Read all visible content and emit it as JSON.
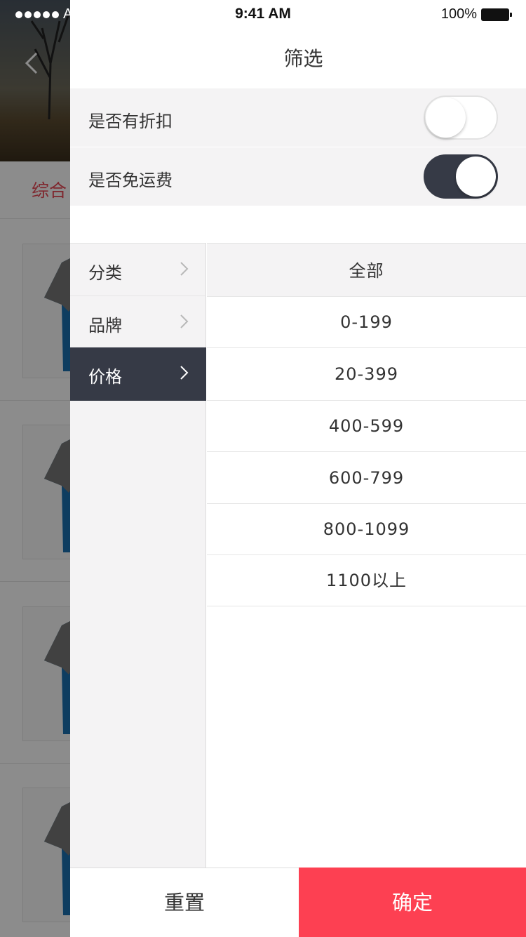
{
  "status_bar": {
    "carrier": "AT&T",
    "time": "9:41 AM",
    "battery": "100%"
  },
  "background": {
    "sort_label": "综合",
    "back_icon": "chevron-left-icon"
  },
  "filter": {
    "title": "筛选",
    "switches": [
      {
        "label": "是否有折扣",
        "on": false
      },
      {
        "label": "是否免运费",
        "on": true
      }
    ],
    "categories": [
      {
        "label": "分类",
        "selected": false
      },
      {
        "label": "品牌",
        "selected": false
      },
      {
        "label": "价格",
        "selected": true
      }
    ],
    "price_options": [
      "全部",
      "0-199",
      "20-399",
      "400-599",
      "600-799",
      "800-1099",
      "1100以上"
    ],
    "reset_label": "重置",
    "confirm_label": "确定"
  },
  "colors": {
    "accent_red": "#fd4052",
    "dark_slate": "#363a46",
    "panel_gray": "#f4f3f4",
    "sort_active": "#e84855"
  }
}
